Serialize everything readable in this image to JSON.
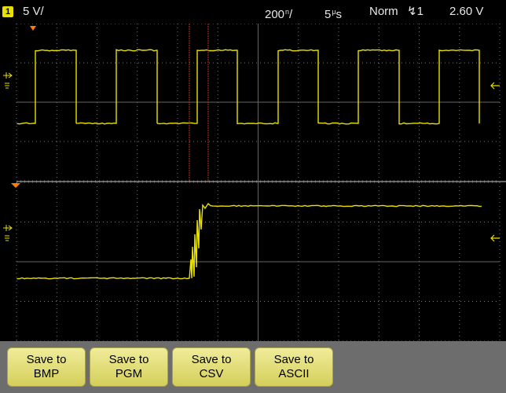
{
  "status": {
    "channel": "1",
    "scale": "5 V/",
    "timebase_num": "200",
    "timebase_sup": "n",
    "timebase_sub": "/",
    "delay_num": "5",
    "delay_sup": "μ",
    "delay_sub": "s",
    "mode": "Norm",
    "trigger_icon": "trigger-edge-falling-icon",
    "trigger_symbol": "↯",
    "trigger_channel": "1",
    "trigger_level": "2.60 V"
  },
  "colors": {
    "trace": "#e8e000",
    "grid": "#7a7a7a",
    "marker_orange": "#ff8000",
    "cursor": "#d03010",
    "softkey": "#e6e27a"
  },
  "softkeys": [
    {
      "line1": "Save to",
      "line2": "BMP"
    },
    {
      "line1": "Save to",
      "line2": "PGM"
    },
    {
      "line1": "Save to",
      "line2": "CSV"
    },
    {
      "line1": "Save to",
      "line2": "ASCII"
    }
  ],
  "waveforms": {
    "main": {
      "type": "square",
      "cycles": 6
    },
    "zoom": {
      "type": "rising-edge-with-ringing"
    }
  }
}
